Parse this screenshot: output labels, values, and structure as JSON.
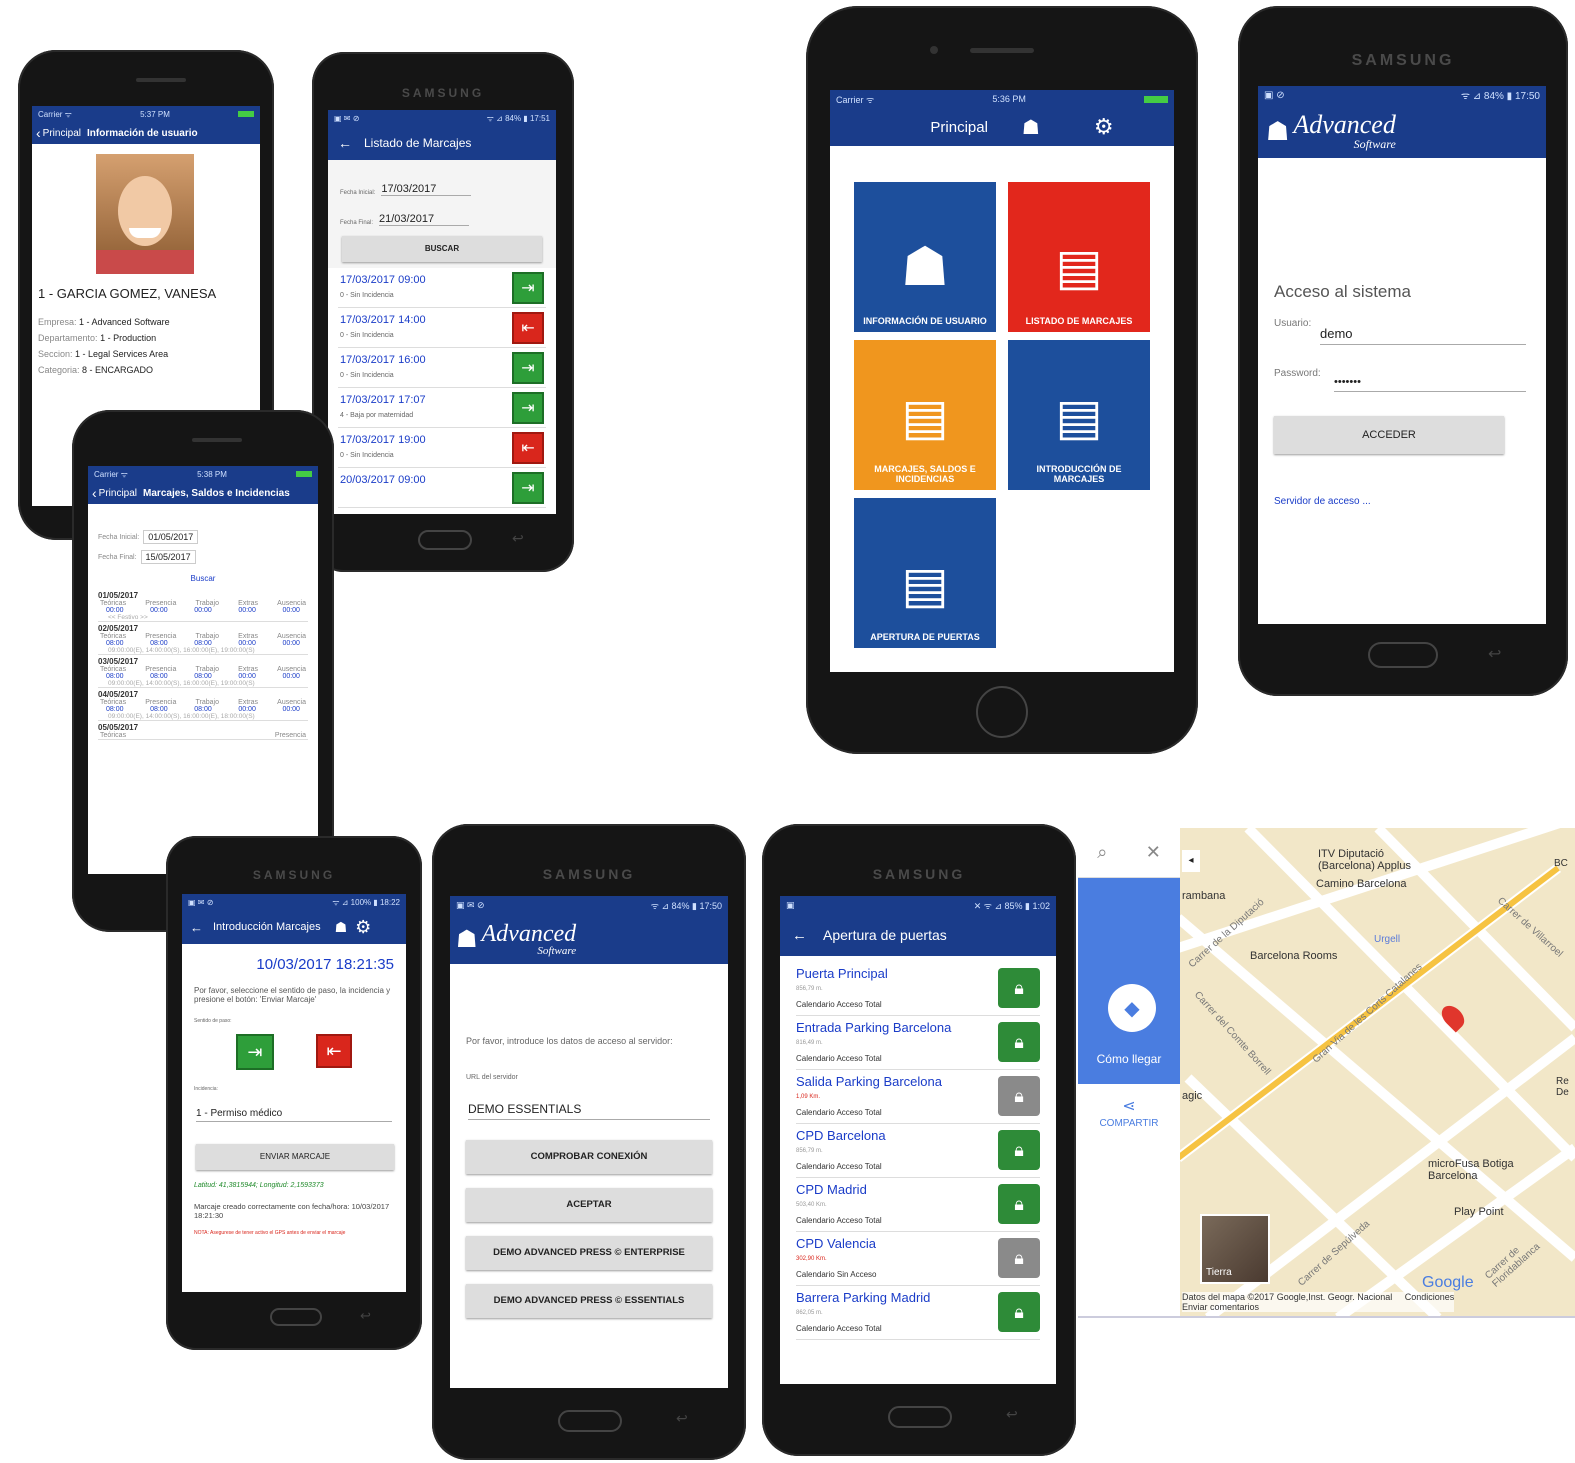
{
  "phone1": {
    "status": {
      "carrier": "Carrier ᯤ",
      "time": "5:37 PM"
    },
    "nav": {
      "back": "Principal",
      "title": "Información de usuario"
    },
    "user_name": "1 - GARCIA GOMEZ, VANESA",
    "details": [
      {
        "label": "Empresa:",
        "value": "1 - Advanced Software"
      },
      {
        "label": "Departamento:",
        "value": "1 - Production"
      },
      {
        "label": "Seccion:",
        "value": "1 - Legal Services Area"
      },
      {
        "label": "Categoria:",
        "value": "8 - ENCARGADO"
      }
    ]
  },
  "phone2": {
    "brand": "SAMSUNG",
    "status": {
      "left": "▣ ✉ ⊘",
      "right": "ᯤ ⊿ 84% ▮ 17:51"
    },
    "title": "Listado de Marcajes",
    "fecha_inicial_label": "Fecha Inicial:",
    "fecha_inicial": "17/03/2017",
    "fecha_final_label": "Fecha Final:",
    "fecha_final": "21/03/2017",
    "buscar": "BUSCAR",
    "rows": [
      {
        "date": "17/03/2017 09:00",
        "note": "0 - Sin Incidencia",
        "type": "in"
      },
      {
        "date": "17/03/2017 14:00",
        "note": "0 - Sin Incidencia",
        "type": "out"
      },
      {
        "date": "17/03/2017 16:00",
        "note": "0 - Sin Incidencia",
        "type": "in"
      },
      {
        "date": "17/03/2017 17:07",
        "note": "4 - Baja por maternidad",
        "type": "in"
      },
      {
        "date": "17/03/2017 19:00",
        "note": "0 - Sin Incidencia",
        "type": "out"
      },
      {
        "date": "20/03/2017 09:00",
        "note": "",
        "type": "in"
      }
    ]
  },
  "phone3": {
    "status": {
      "carrier": "Carrier ᯤ",
      "time": "5:38 PM"
    },
    "nav": {
      "back": "Principal",
      "title": "Marcajes, Saldos e Incidencias"
    },
    "fecha_inicial_label": "Fecha Inicial:",
    "fecha_inicial": "01/05/2017",
    "fecha_final_label": "Fecha Final:",
    "fecha_final": "15/05/2017",
    "buscar": "Buscar",
    "cols": [
      "Teóricas",
      "Presencia",
      "Trabajo",
      "Extras",
      "Ausencia"
    ],
    "days": [
      {
        "date": "01/05/2017",
        "vals": [
          "00:00",
          "00:00",
          "00:00",
          "00:00",
          "00:00"
        ],
        "note": "<< Festivo >>"
      },
      {
        "date": "02/05/2017",
        "vals": [
          "08:00",
          "08:00",
          "08:00",
          "00:00",
          "00:00"
        ],
        "note": "09:00:00(E), 14:00:00(S), 16:00:00(E), 19:00:00(S)"
      },
      {
        "date": "03/05/2017",
        "vals": [
          "08:00",
          "08:00",
          "08:00",
          "00:00",
          "00:00"
        ],
        "note": "09:00:00(E), 14:00:00(S), 16:00:00(E), 19:00:00(S)"
      },
      {
        "date": "04/05/2017",
        "vals": [
          "08:00",
          "08:00",
          "08:00",
          "00:00",
          "00:00"
        ],
        "note": "09:00:00(E), 14:00:00(S), 16:00:00(E), 18:00:00(S)"
      },
      {
        "date": "05/05/2017",
        "vals": [],
        "note": ""
      }
    ],
    "last_col_partial": [
      "Teóricas",
      "Pres"
    ]
  },
  "phone4": {
    "status": {
      "carrier": "Carrier ᯤ",
      "time": "5:36 PM"
    },
    "title": "Principal",
    "tiles": [
      {
        "label": "INFORMACIÓN DE USUARIO",
        "color": "#1d4f9c"
      },
      {
        "label": "LISTADO DE MARCAJES",
        "color": "#e2271c"
      },
      {
        "label": "MARCAJES, SALDOS E INCIDENCIAS",
        "color": "#f0961e"
      },
      {
        "label": "INTRODUCCIÓN DE MARCAJES",
        "color": "#1d4f9c"
      },
      {
        "label": "APERTURA DE PUERTAS",
        "color": "#1d4f9c"
      }
    ]
  },
  "phone5": {
    "brand": "SAMSUNG",
    "status": {
      "left": "▣ ⊘",
      "right": "ᯤ ⊿ 84% ▮ 17:50"
    },
    "logo_main": "Advanced",
    "logo_sub": "Software",
    "heading": "Acceso al sistema",
    "usuario_label": "Usuario:",
    "usuario": "demo",
    "password_label": "Password:",
    "password": "•••••••",
    "acceder": "ACCEDER",
    "servidor_link": "Servidor de acceso ..."
  },
  "phone6": {
    "brand": "SAMSUNG",
    "status": {
      "left": "▣ ✉ ⊘",
      "right": "ᯤ ⊿ 100% ▮ 18:22"
    },
    "title": "Introducción Marcajes",
    "datetime": "10/03/2017 18:21:35",
    "instructions": "Por favor, seleccione el sentido de paso, la incidencia y presione el botón: 'Enviar Marcaje'",
    "sentido_label": "Sentido de paso:",
    "incidencia_label": "Incidencia:",
    "incidencia": "1 - Permiso médico",
    "enviar": "ENVIAR MARCAJE",
    "coords": "Latitud: 41,3815944; Longitud: 2,1593373",
    "result": "Marcaje creado correctamente con fecha/hora: 10/03/2017 18:21:30",
    "nota": "NOTA: Asegurese de tener activo el GPS antes de enviar el marcaje"
  },
  "phone7": {
    "brand": "SAMSUNG",
    "status": {
      "left": "▣ ✉ ⊘",
      "right": "ᯤ ⊿ 84% ▮ 17:50"
    },
    "logo_main": "Advanced",
    "logo_sub": "Software",
    "instructions": "Por favor, introduce los datos de acceso al servidor:",
    "url_label": "URL del servidor",
    "url_value": "DEMO ESSENTIALS",
    "buttons": [
      "COMPROBAR CONEXIÓN",
      "ACEPTAR",
      "DEMO ADVANCED PRESS © ENTERPRISE",
      "DEMO ADVANCED PRESS © ESSENTIALS"
    ]
  },
  "phone8": {
    "brand": "SAMSUNG",
    "status": {
      "left": "▣",
      "right": "✕ ᯤ ⊿ 85% ▮ 1:02"
    },
    "title": "Apertura de puertas",
    "doors": [
      {
        "name": "Puerta Principal",
        "dist": "856,79 m.",
        "cal": "Calendario Acceso Total",
        "enabled": true,
        "red": false
      },
      {
        "name": "Entrada Parking Barcelona",
        "dist": "816,49 m.",
        "cal": "Calendario Acceso Total",
        "enabled": true,
        "red": false
      },
      {
        "name": "Salida Parking Barcelona",
        "dist": "1,09 Km.",
        "cal": "Calendario Acceso Total",
        "enabled": false,
        "red": true
      },
      {
        "name": "CPD Barcelona",
        "dist": "856,79 m.",
        "cal": "Calendario Acceso Total",
        "enabled": true,
        "red": false
      },
      {
        "name": "CPD Madrid",
        "dist": "503,40 Km.",
        "cal": "Calendario Acceso Total",
        "enabled": true,
        "red": false
      },
      {
        "name": "CPD Valencia",
        "dist": "302,90 Km.",
        "cal": "Calendario Sin Acceso",
        "enabled": false,
        "red": true
      },
      {
        "name": "Barrera Parking Madrid",
        "dist": "862,05 m.",
        "cal": "Calendario Acceso Total",
        "enabled": true,
        "red": false
      }
    ]
  },
  "map": {
    "como_llegar": "Cómo llegar",
    "compartir": "COMPARTIR",
    "labels": [
      "ITV Diputació (Barcelona) Applus",
      "Camino Barcelona",
      "rambana",
      "Carrer de la Diputació",
      "Barcelona Rooms",
      "Urgell",
      "Carrer de Villarroel",
      "Carrer del Comte Borrell",
      "Gran Via de les Corts Catalanes",
      "agic",
      "microFusa Botiga Barcelona",
      "Play Point",
      "Carrer de Sepúlveda",
      "Carrer de Floridablanca",
      "Re De",
      "BC"
    ],
    "tierra": "Tierra",
    "google": "Google",
    "footer": "Datos del mapa ©2017 Google,Inst. Geogr. Nacional",
    "condiciones": "Condiciones",
    "comentarios": "Enviar comentarios"
  },
  "colors": {
    "primary": "#1a3c8a",
    "link": "#1a3cc8",
    "green": "#2e9e3a",
    "red": "#d9261c",
    "orange": "#f0961e"
  }
}
